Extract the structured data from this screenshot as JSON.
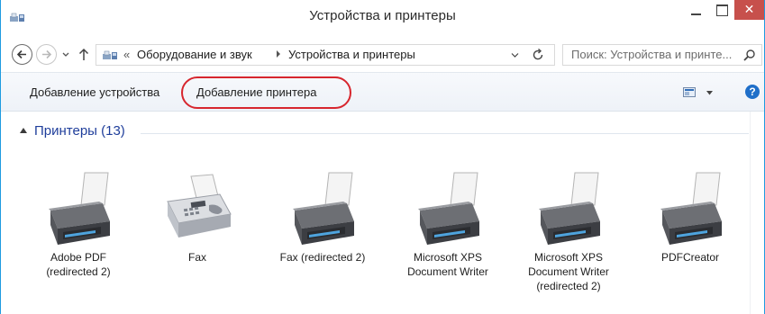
{
  "window": {
    "title": "Устройства и принтеры",
    "close_glyph": "✕",
    "accent": "#1e9be0",
    "close_color": "#c7504c"
  },
  "address": {
    "overflow": "«",
    "crumbs": [
      "Оборудование и звук",
      "Устройства и принтеры"
    ]
  },
  "search": {
    "placeholder": "Поиск: Устройства и принте..."
  },
  "commands": {
    "add_device": "Добавление устройства",
    "add_printer": "Добавление принтера",
    "highlight_color": "#d7262e"
  },
  "help": {
    "glyph": "?"
  },
  "group": {
    "title": "Принтеры (13)",
    "title_color": "#1f3e9b"
  },
  "devices": [
    {
      "label": "Adobe PDF\n(redirected 2)",
      "icon": "printer-icon"
    },
    {
      "label": "Fax",
      "icon": "fax-icon"
    },
    {
      "label": "Fax (redirected 2)",
      "icon": "printer-icon"
    },
    {
      "label": "Microsoft XPS\nDocument Writer",
      "icon": "printer-icon"
    },
    {
      "label": "Microsoft XPS\nDocument Writer\n(redirected 2)",
      "icon": "printer-icon"
    },
    {
      "label": "PDFCreator",
      "icon": "printer-icon"
    }
  ]
}
